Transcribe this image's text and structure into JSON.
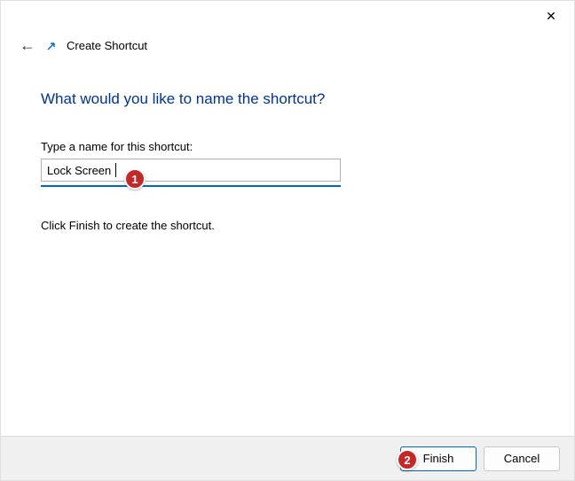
{
  "titlebar": {
    "close_label": "✕"
  },
  "header": {
    "back_glyph": "←",
    "title": "Create Shortcut"
  },
  "main": {
    "heading": "What would you like to name the shortcut?",
    "field_label": "Type a name for this shortcut:",
    "input_value": "Lock Screen",
    "helper_text": "Click Finish to create the shortcut."
  },
  "footer": {
    "finish_label": "Finish",
    "cancel_label": "Cancel"
  },
  "annotations": {
    "badge1": "1",
    "badge2": "2"
  }
}
